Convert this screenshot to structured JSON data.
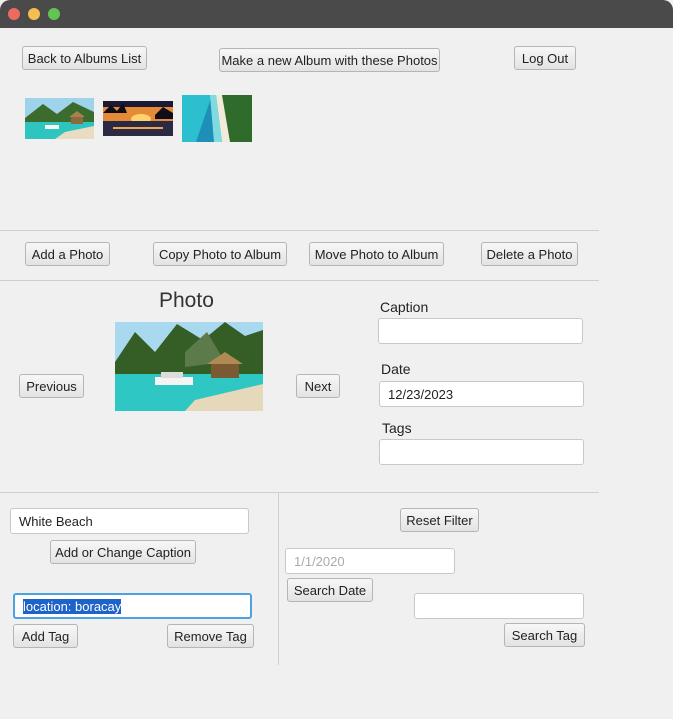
{
  "top": {
    "back_label": "Back to Albums List",
    "new_album_label": "Make a new Album with these Photos",
    "logout_label": "Log Out"
  },
  "thumbnails": [
    {
      "name": "tropical-lagoon-hut"
    },
    {
      "name": "sunset-beach"
    },
    {
      "name": "white-beach-aerial"
    }
  ],
  "actions": {
    "add_photo": "Add a Photo",
    "copy_photo": "Copy Photo to Album",
    "move_photo": "Move Photo to Album",
    "delete_photo": "Delete a Photo"
  },
  "viewer": {
    "title": "Photo",
    "previous": "Previous",
    "next": "Next"
  },
  "details": {
    "caption_label": "Caption",
    "caption_value": "",
    "date_label": "Date",
    "date_value": "12/23/2023",
    "tags_label": "Tags",
    "tags_value": ""
  },
  "edit": {
    "caption_input": "White Beach",
    "caption_button": "Add or Change Caption",
    "tag_input": "location: boracay",
    "add_tag": "Add Tag",
    "remove_tag": "Remove Tag"
  },
  "search": {
    "reset_filter": "Reset Filter",
    "date_placeholder": "1/1/2020",
    "search_date": "Search Date",
    "tag_value": "",
    "search_tag": "Search Tag"
  }
}
